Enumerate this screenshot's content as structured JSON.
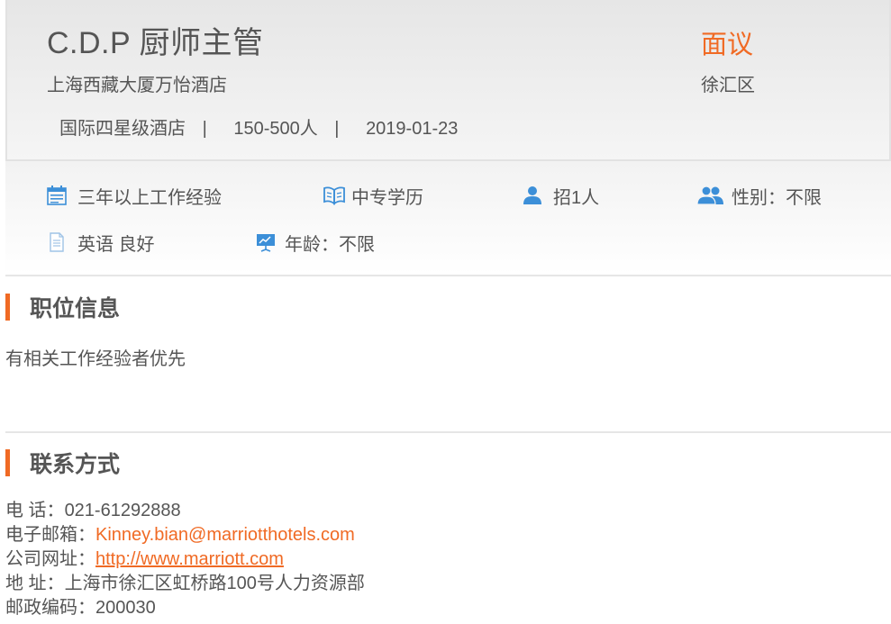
{
  "header": {
    "job_title": "C.D.P 厨师主管",
    "salary": "面议",
    "company": "上海西藏大厦万怡酒店",
    "district": "徐汇区",
    "hotel_type": "国际四星级酒店",
    "company_size": "150-500人",
    "post_date": "2019-01-23",
    "separator": "|"
  },
  "attributes": {
    "experience": {
      "icon": "calendar-icon",
      "label": "三年以上工作经验"
    },
    "education": {
      "icon": "book-icon",
      "label": "中专学历"
    },
    "headcount": {
      "icon": "person-icon",
      "label": "招1人"
    },
    "gender": {
      "icon": "people-icon",
      "label": "性别：不限"
    },
    "language": {
      "icon": "document-icon",
      "label": "英语 良好"
    },
    "age": {
      "icon": "presentation-icon",
      "label": "年龄：不限"
    }
  },
  "job_info": {
    "heading": "职位信息",
    "description": "有相关工作经验者优先"
  },
  "contact": {
    "heading": "联系方式",
    "phone_label": "电 话：",
    "phone": "021-61292888",
    "email_label": "电子邮箱：",
    "email": "Kinney.bian@marriotthotels.com",
    "website_label": "公司网址：",
    "website": "http://www.marriott.com",
    "address_label": "地 址：",
    "address": "上海市徐汇区虹桥路100号人力资源部",
    "postcode_label": "邮政编码：",
    "postcode": "200030"
  },
  "colors": {
    "accent": "#f06a24",
    "icon_blue": "#3c8fd8",
    "text": "#555555"
  }
}
